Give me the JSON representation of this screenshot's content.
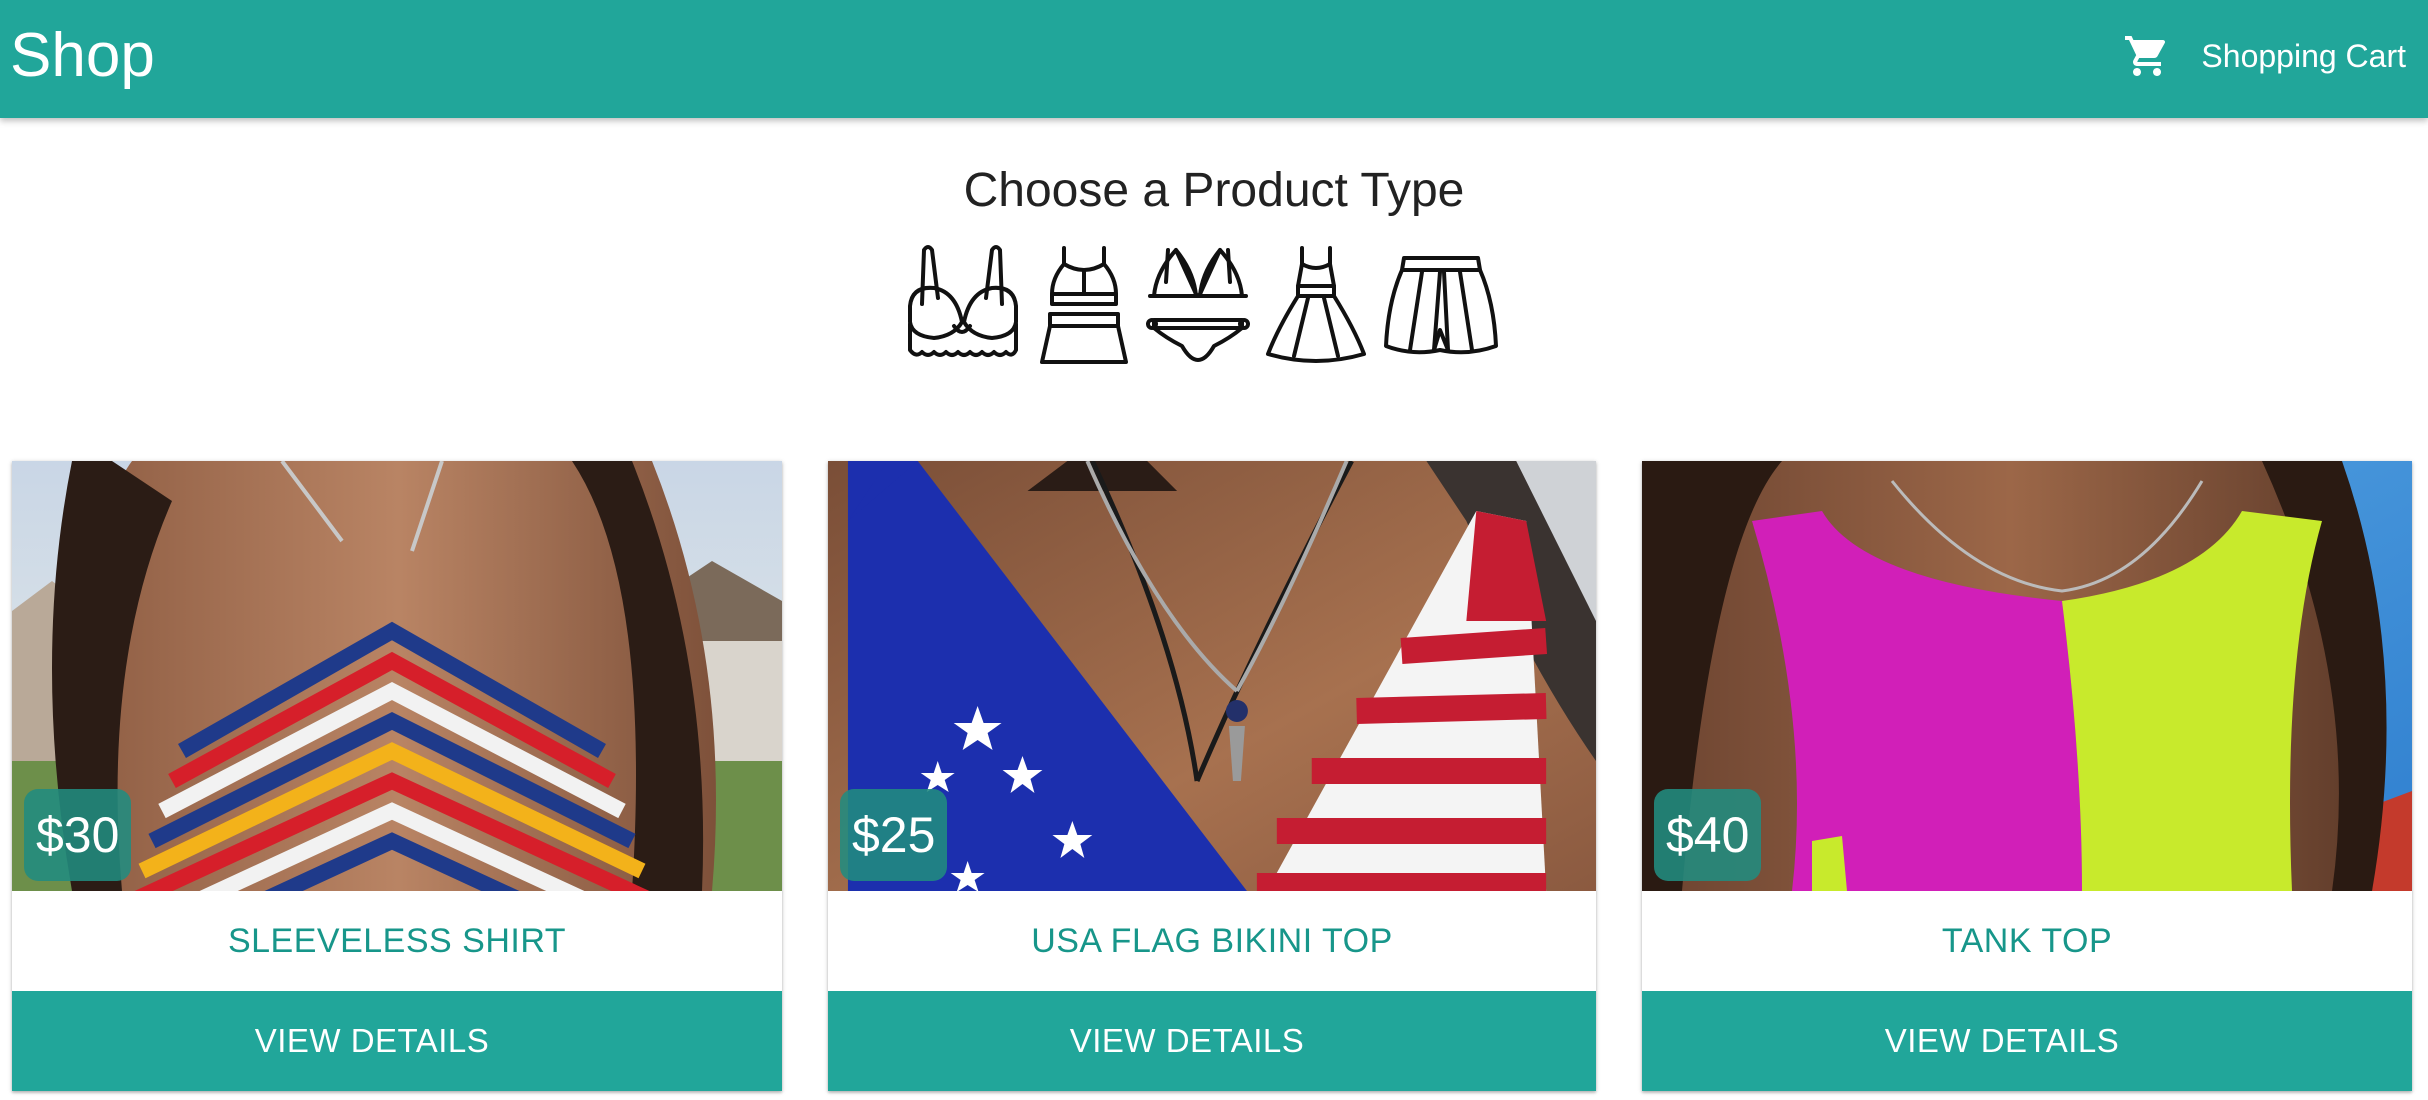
{
  "appbar": {
    "brand": "Shop",
    "cart_label": "Shopping Cart",
    "cart_icon": "shopping-cart-icon",
    "color": "#21a69a"
  },
  "heading": "Choose a Product Type",
  "product_types": [
    {
      "icon": "bra-icon"
    },
    {
      "icon": "crop-top-skirt-set-icon"
    },
    {
      "icon": "bikini-icon"
    },
    {
      "icon": "dress-icon"
    },
    {
      "icon": "skirt-icon"
    }
  ],
  "products": [
    {
      "price": "$30",
      "title": "SLEEVELESS SHIRT",
      "button": "VIEW DETAILS",
      "image": "photo of a chevron crochet halter top in red, white, blue and yellow"
    },
    {
      "price": "$25",
      "title": "USA FLAG BIKINI TOP",
      "button": "VIEW DETAILS",
      "image": "photo of a crochet American flag bikini top"
    },
    {
      "price": "$40",
      "title": "TANK TOP",
      "button": "VIEW DETAILS",
      "image": "photo of a magenta and lime crochet tank top"
    }
  ]
}
